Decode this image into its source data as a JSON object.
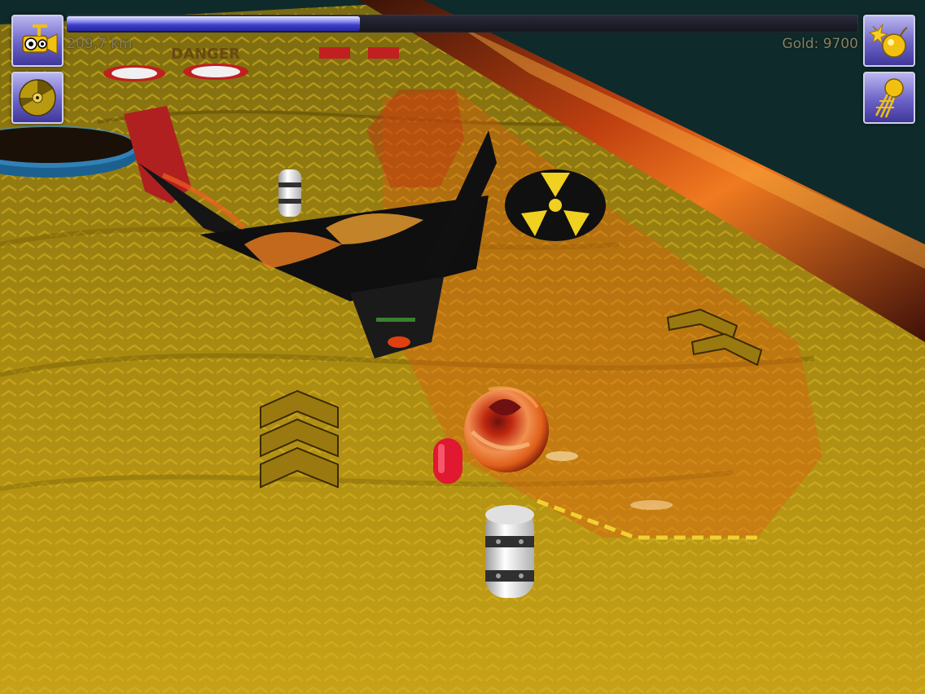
{
  "hud": {
    "distance": "209,7 km",
    "gold": "Gold: 9700",
    "progress": 0.37
  },
  "buttons": {
    "camera": "camera-icon",
    "music": "music-disc-icon",
    "bomb": "bomb-icon",
    "jump": "jump-ball-icon"
  },
  "scene": {
    "sign_text": "DANGER",
    "colors": {
      "floor": "#a88a10",
      "ui_purple": "#6b63c6",
      "fire": "#e0501a"
    }
  }
}
